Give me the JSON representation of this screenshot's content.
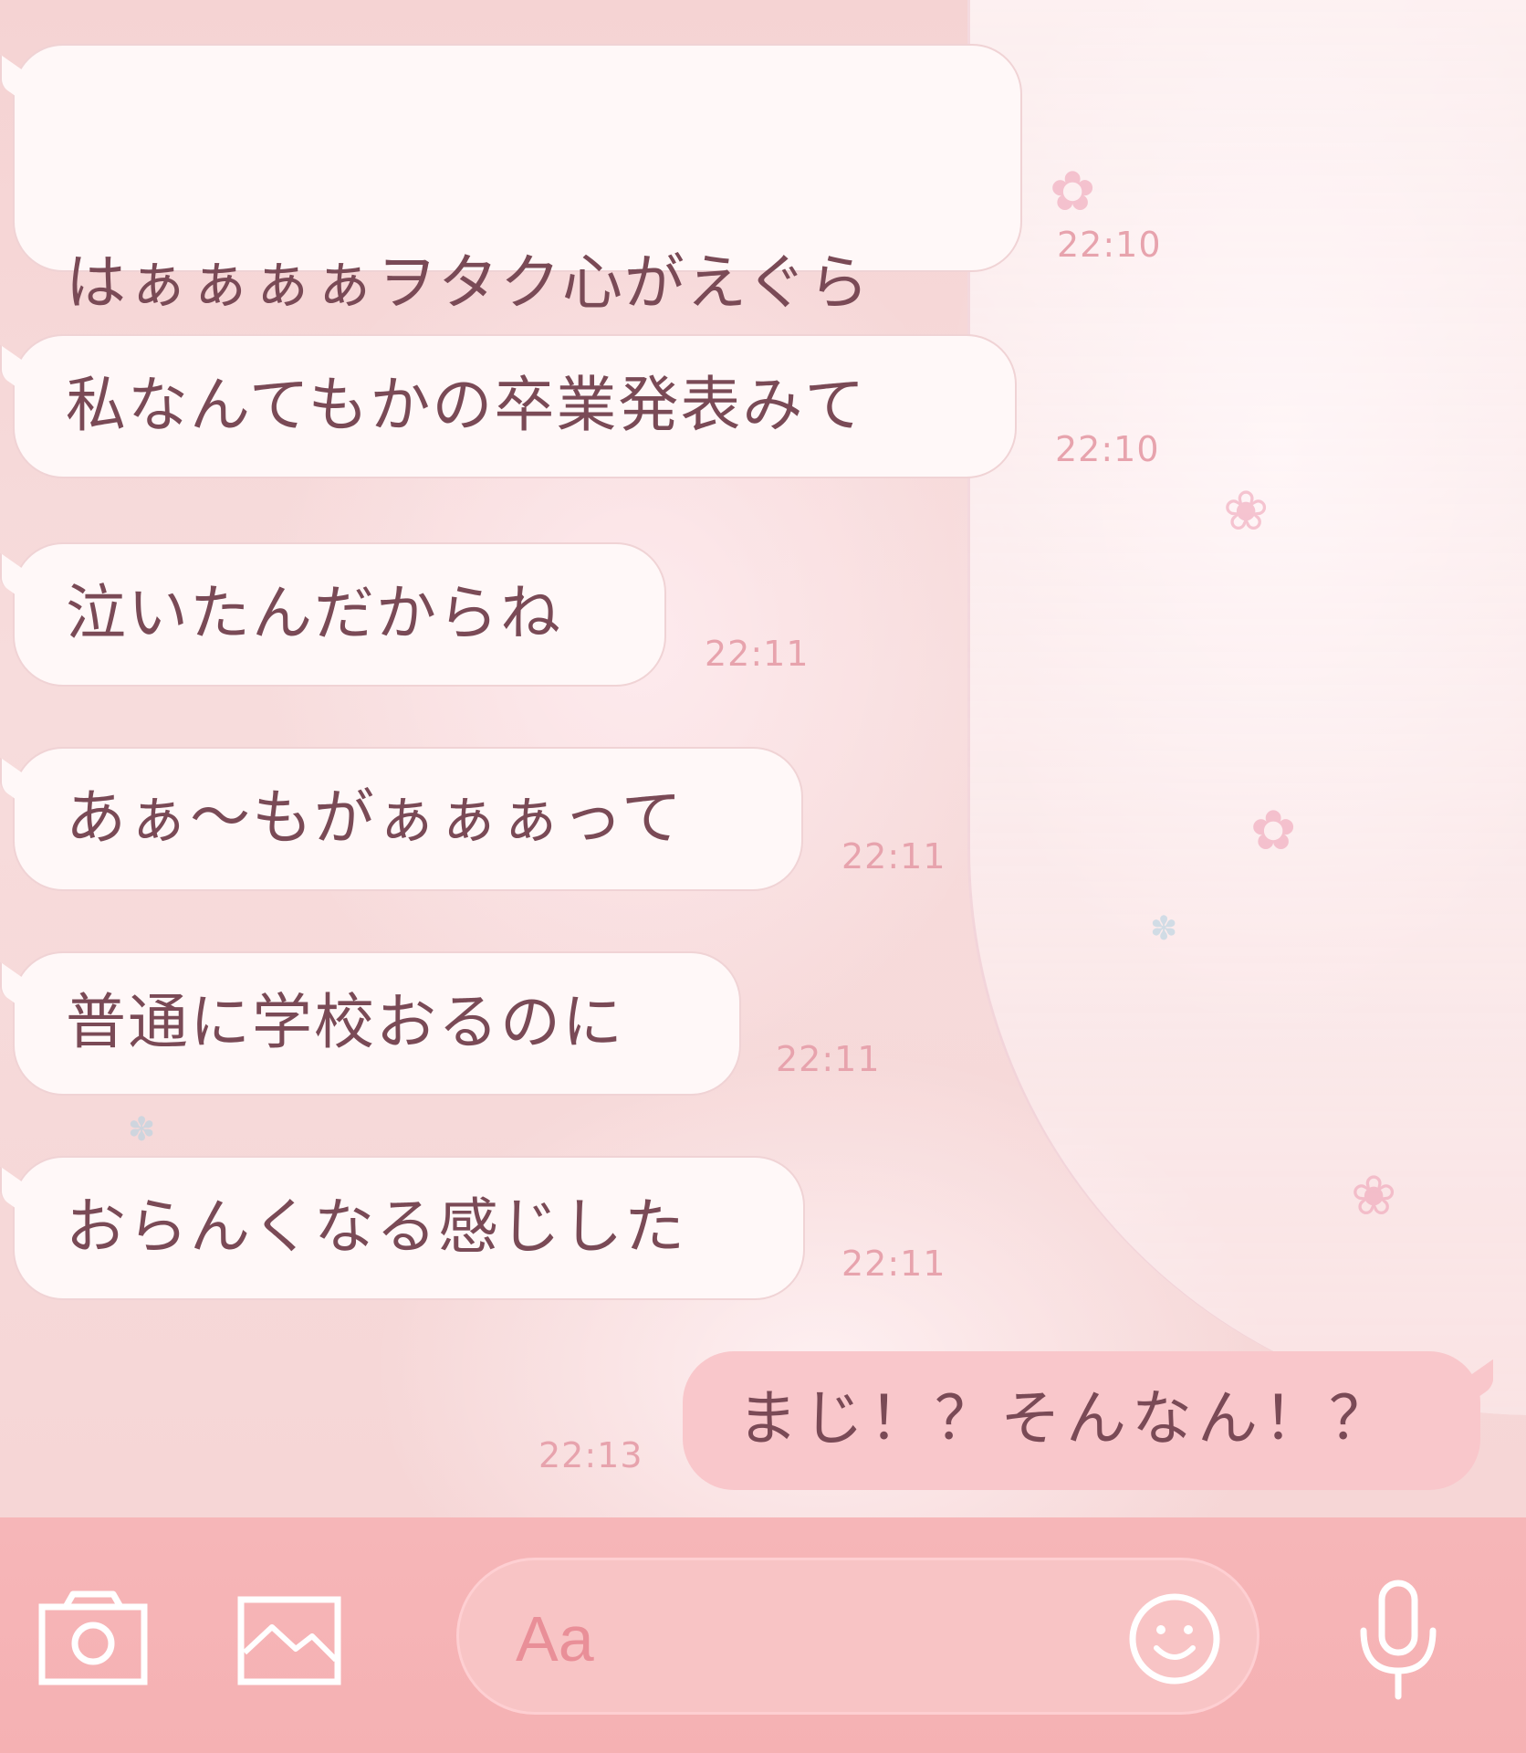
{
  "messages": [
    {
      "text": "はぁぁぁぁヲタク心がえぐら\nれた",
      "time": "22:10"
    },
    {
      "text": "私なんてもかの卒業発表みて",
      "time": "22:10"
    },
    {
      "text": "泣いたんだからね",
      "time": "22:11"
    },
    {
      "text": "あぁ〜もがぁぁぁって",
      "time": "22:11"
    },
    {
      "text": "普通に学校おるのに",
      "time": "22:11"
    },
    {
      "text": "おらんくなる感じした",
      "time": "22:11"
    }
  ],
  "my_message": {
    "text": "まじ！？そんなん！？",
    "time": "22:13"
  },
  "input": {
    "placeholder": "Aa"
  },
  "icons": {
    "camera": "camera-icon",
    "image": "image-icon",
    "emoji": "smiley-icon",
    "mic": "microphone-icon"
  },
  "colors": {
    "bar": "#f5b4b6",
    "bubble_in": "#fff8f8",
    "bubble_out": "#f9c7cb",
    "text": "#7a4a56",
    "time": "#e7a3ad"
  }
}
